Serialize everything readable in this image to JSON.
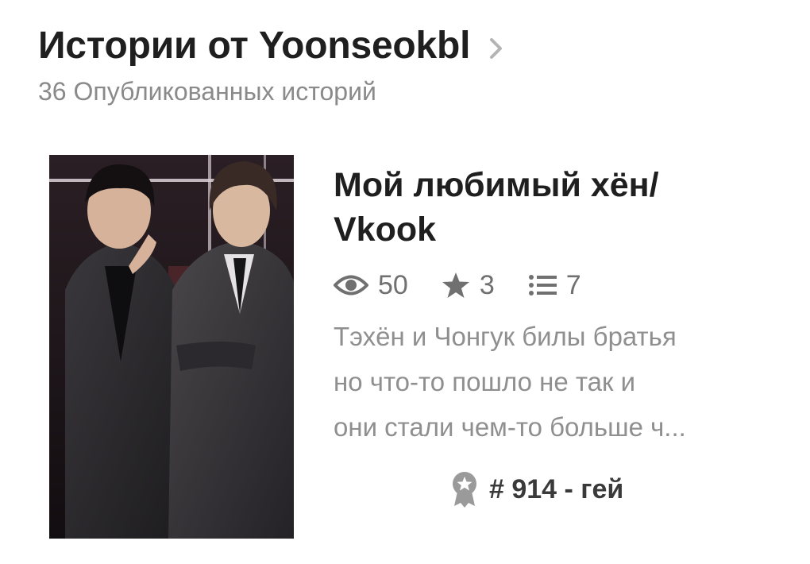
{
  "header": {
    "title": "Истории от Yoonseokbl",
    "subtitle": "36 Опубликованных историй"
  },
  "story": {
    "title_line1": "Мой любимый хён/",
    "title_line2": "Vkook",
    "cover_icon": "cover-photo-two-men-in-suits",
    "stats": {
      "views": "50",
      "votes": "3",
      "parts": "7"
    },
    "description_lines": [
      "Тэхён и Чонгук билы братья",
      "но что-то пошло не так и",
      "они стали чем-то больше ч..."
    ],
    "rank": "# 914 - гей"
  },
  "colors": {
    "title": "#1f1f1f",
    "secondary": "#8a8a8a",
    "icons": "#707070",
    "rank_icon": "#9a9a9a"
  }
}
